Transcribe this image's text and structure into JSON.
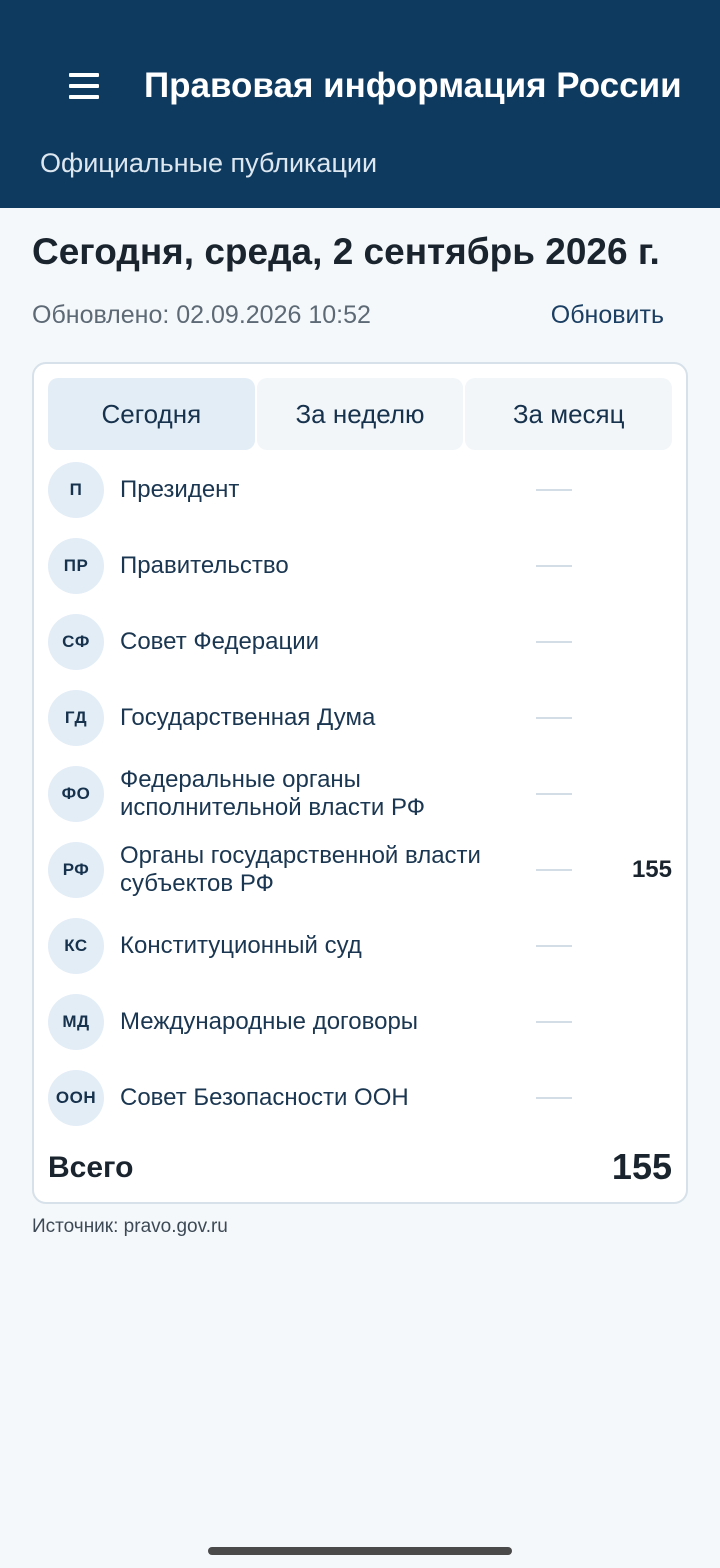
{
  "app_bar": {
    "title": "Правовая информация России",
    "subtitle": "Официальные публикации",
    "menu_icon": "hamburger-menu-icon"
  },
  "header": {
    "date_heading": "Сегодня, среда, 2 сентябрь 2026 г.",
    "updated_text": "Обновлено: 02.09.2026 10:52",
    "refresh_label": "Обновить"
  },
  "tabs": [
    {
      "label": "Сегодня",
      "selected": true
    },
    {
      "label": "За неделю",
      "selected": false
    },
    {
      "label": "За месяц",
      "selected": false
    }
  ],
  "rows": [
    {
      "code": "П",
      "label": "Президент",
      "count": ""
    },
    {
      "code": "ПР",
      "label": "Правительство",
      "count": ""
    },
    {
      "code": "СФ",
      "label": "Совет Федерации",
      "count": ""
    },
    {
      "code": "ГД",
      "label": "Государственная Дума",
      "count": ""
    },
    {
      "code": "ФО",
      "label": "Федеральные органы исполнительной власти РФ",
      "count": ""
    },
    {
      "code": "РФ",
      "label": "Органы государственной власти субъектов РФ",
      "count": "155"
    },
    {
      "code": "КС",
      "label": "Конституционный суд",
      "count": ""
    },
    {
      "code": "МД",
      "label": "Международные договоры",
      "count": ""
    },
    {
      "code": "ООН",
      "label": "Совет Безопасности ООН",
      "count": ""
    }
  ],
  "total": {
    "label": "Всего",
    "value": "155"
  },
  "source": "Источник: pravo.gov.ru",
  "colors": {
    "app_bar": "#0f3a60",
    "background": "#f5f8fa",
    "badge": "#e3edf6",
    "active_tab": "#e3edf6"
  }
}
